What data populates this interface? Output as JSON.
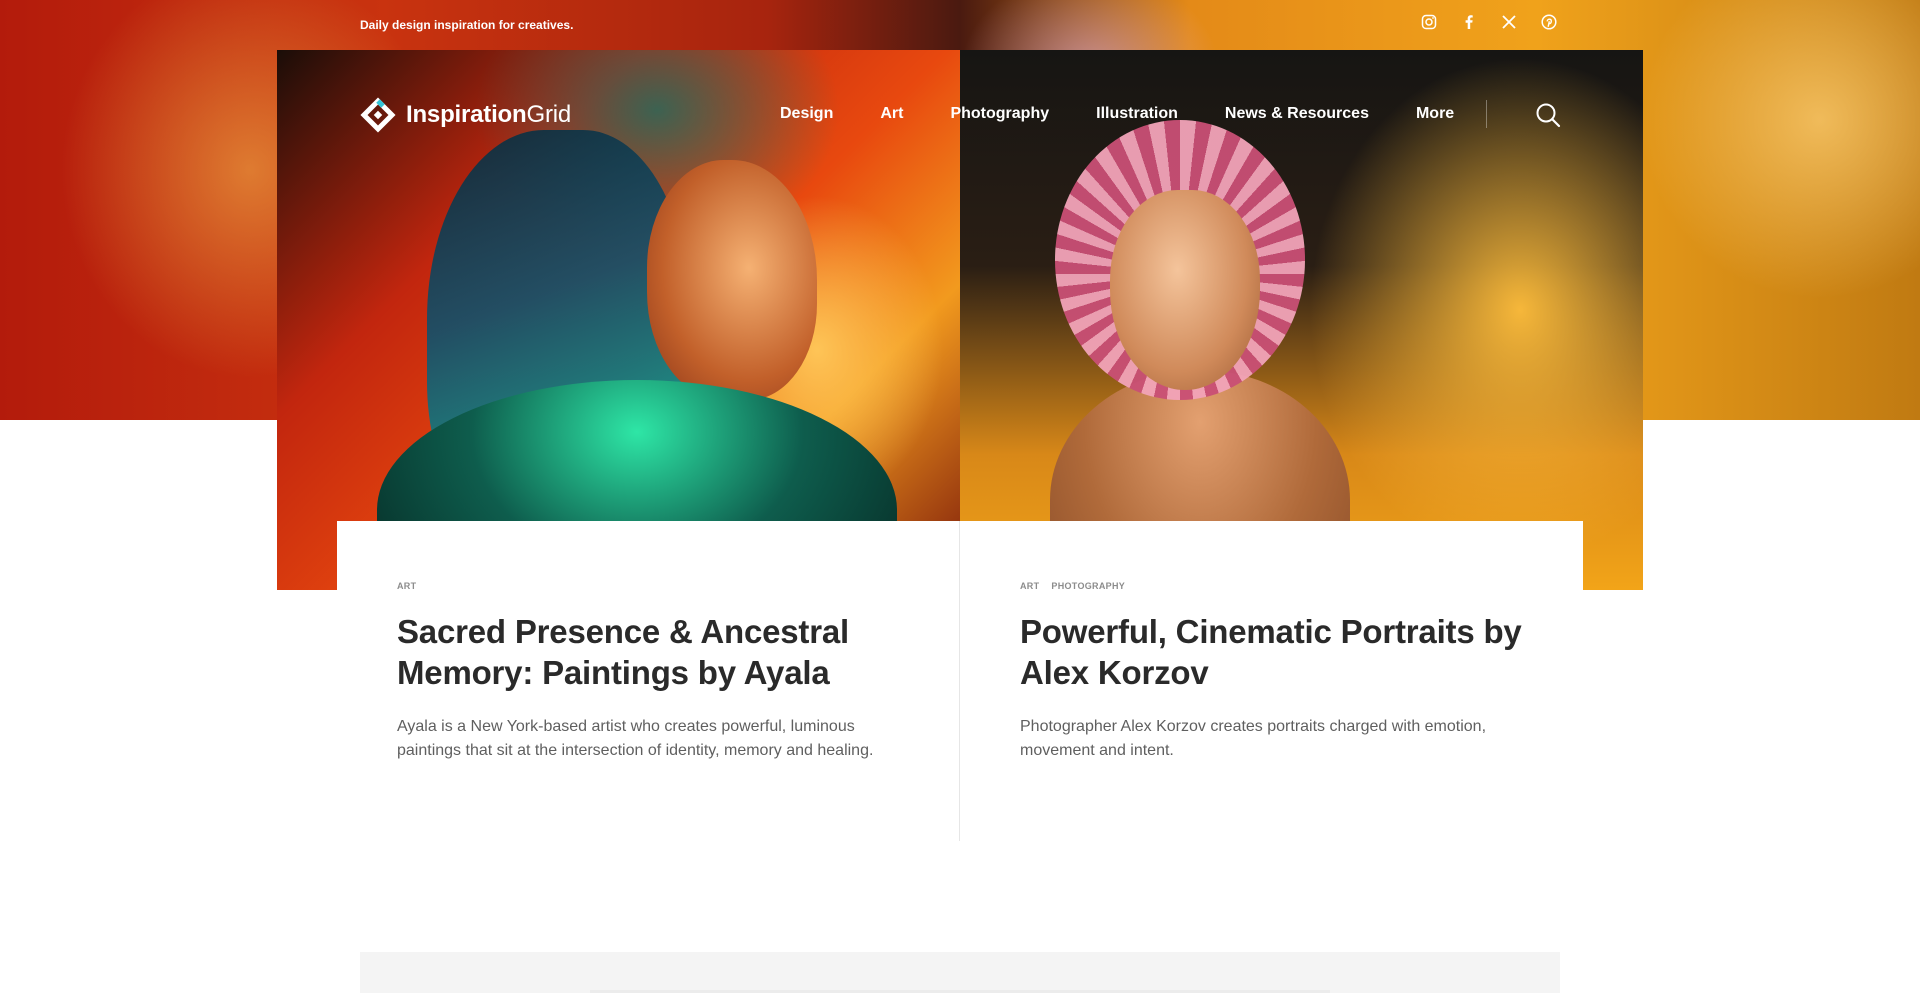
{
  "topbar": {
    "tagline": "Daily design inspiration for creatives.",
    "socials": [
      {
        "icon": "instagram-icon"
      },
      {
        "icon": "facebook-icon"
      },
      {
        "icon": "x-twitter-icon"
      },
      {
        "icon": "pinterest-icon"
      }
    ]
  },
  "header": {
    "logo_bold": "Inspiration",
    "logo_light": "Grid",
    "nav": [
      "Design",
      "Art",
      "Photography",
      "Illustration",
      "News & Resources",
      "More"
    ],
    "search_icon": "search-icon"
  },
  "articles": [
    {
      "tags": [
        "ART"
      ],
      "title": "Sacred Presence & Ancestral Memory: Paintings by Ayala",
      "excerpt": "Ayala is a New York-based artist who creates powerful, luminous paintings that sit at the intersection of identity, memory and healing."
    },
    {
      "tags": [
        "ART",
        "PHOTOGRAPHY"
      ],
      "title": "Powerful, Cinematic Portraits by Alex Korzov",
      "excerpt": "Photographer Alex Korzov creates portraits charged with emotion, movement and intent."
    }
  ],
  "colors": {
    "accent": "#35c4d8",
    "heading": "#2a2a2a",
    "body": "#5f5f5f",
    "tag": "#8c8c8c"
  }
}
